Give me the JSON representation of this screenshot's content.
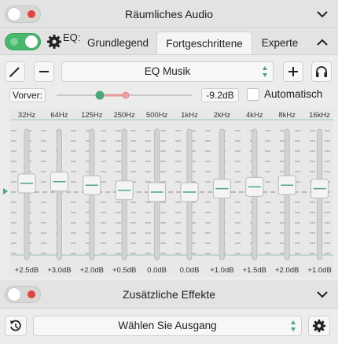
{
  "spatial": {
    "title": "Räumliches Audio"
  },
  "eq": {
    "label": "EQ:",
    "tabs": [
      "Grundlegend",
      "Fortgeschrittene",
      "Experte"
    ],
    "active_tab": 1,
    "preset": "EQ Musik",
    "preamp_label": "Vorver:",
    "preamp_value": "-9.2dB",
    "auto_label": "Automatisch",
    "bands": [
      {
        "freq": "32Hz",
        "gain_label": "+2.5dB",
        "gain": 2.5
      },
      {
        "freq": "64Hz",
        "gain_label": "+3.0dB",
        "gain": 3.0
      },
      {
        "freq": "125Hz",
        "gain_label": "+2.0dB",
        "gain": 2.0
      },
      {
        "freq": "250Hz",
        "gain_label": "+0.5dB",
        "gain": 0.5
      },
      {
        "freq": "500Hz",
        "gain_label": "0.0dB",
        "gain": 0.0
      },
      {
        "freq": "1kHz",
        "gain_label": "0.0dB",
        "gain": 0.0
      },
      {
        "freq": "2kHz",
        "gain_label": "+1.0dB",
        "gain": 1.0
      },
      {
        "freq": "4kHz",
        "gain_label": "+1.5dB",
        "gain": 1.5
      },
      {
        "freq": "8kHz",
        "gain_label": "+2.0dB",
        "gain": 2.0
      },
      {
        "freq": "16kHz",
        "gain_label": "+1.0dB",
        "gain": 1.0
      }
    ]
  },
  "effects": {
    "title": "Zusätzliche Effekte"
  },
  "output": {
    "placeholder": "Wählen Sie Ausgang"
  },
  "colors": {
    "accent": "#4aa77a",
    "toggle_on": "#49b86f",
    "toggle_off_dot": "#e0443d"
  }
}
